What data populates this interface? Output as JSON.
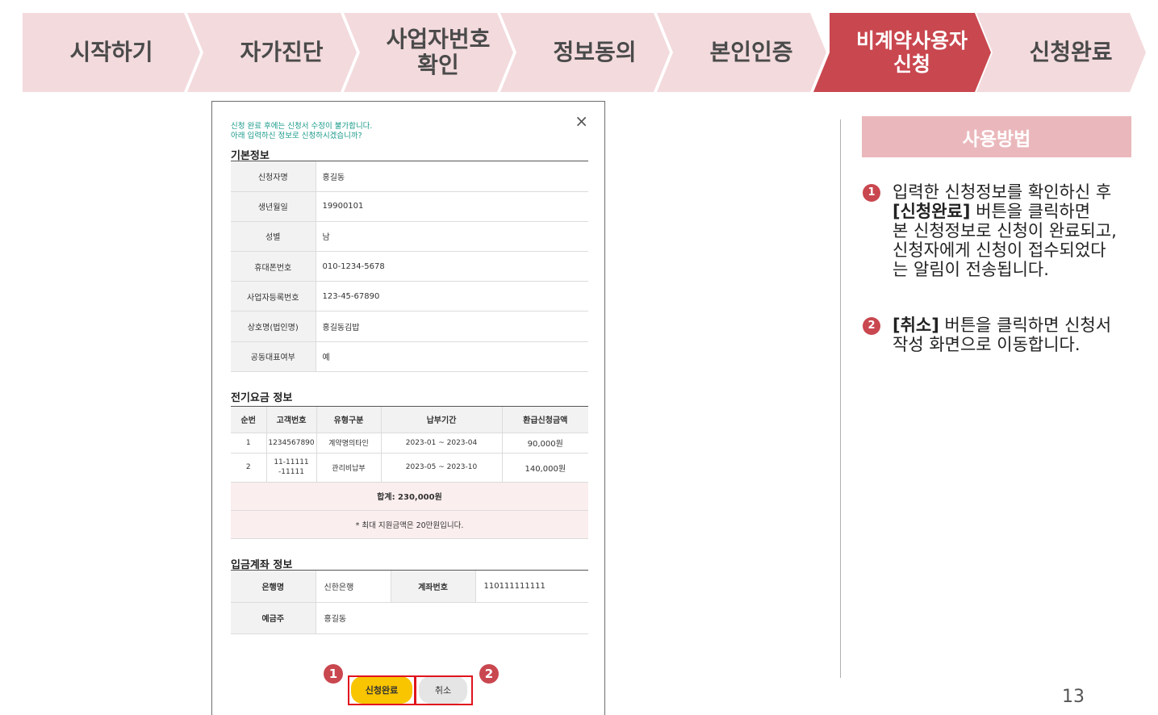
{
  "steps": [
    {
      "label": "시작하기",
      "active": false
    },
    {
      "label": "자가진단",
      "active": false
    },
    {
      "label": "사업자번호\n확인",
      "active": false
    },
    {
      "label": "정보동의",
      "active": false
    },
    {
      "label": "본인인증",
      "active": false
    },
    {
      "label": "비계약사용자\n신청",
      "active": true
    },
    {
      "label": "신청완료",
      "active": false
    }
  ],
  "modal": {
    "close_icon": "×",
    "notice_line1": "신청 완료 후에는 신청서 수정이 불가합니다.",
    "notice_line2": "아래 입력하신 정보로 신청하시겠습니까?",
    "basic_title": "기본정보",
    "basic": [
      {
        "label": "신청자명",
        "value": "홍길동"
      },
      {
        "label": "생년월일",
        "value": "19900101"
      },
      {
        "label": "성별",
        "value": "남"
      },
      {
        "label": "휴대폰번호",
        "value": "010-1234-5678"
      },
      {
        "label": "사업자등록번호",
        "value": "123-45-67890"
      },
      {
        "label": "상호명(법인명)",
        "value": "홍길동김밥"
      },
      {
        "label": "공동대표여부",
        "value": "예"
      }
    ],
    "fee_title": "전기요금 정보",
    "fee_headers": [
      "순번",
      "고객번호",
      "유형구분",
      "납부기간",
      "환급신청금액"
    ],
    "fee_rows": [
      [
        "1",
        "1234567890",
        "계약명의타인",
        "2023-01 ~ 2023-04",
        "90,000원"
      ],
      [
        "2",
        "11-11111\n-11111",
        "관리비납부",
        "2023-05 ~ 2023-10",
        "140,000원"
      ]
    ],
    "fee_total": "합계: 230,000원",
    "fee_note": "* 최대 지원금액은 20만원입니다.",
    "account_title": "입금계좌 정보",
    "bank_label": "은행명",
    "bank_value": "신한은행",
    "acct_label": "계좌번호",
    "acct_value": "110111111111",
    "holder_label": "예금주",
    "holder_value": "홍길동",
    "submit_label": "신청완료",
    "cancel_label": "취소",
    "marker1": "1",
    "marker2": "2"
  },
  "guide": {
    "title": "사용방법",
    "item1_num": "1",
    "item1_line1": "입력한 신청정보를 확인하신 후",
    "item1_bold": "[신청완료]",
    "item1_after_bold": " 버튼을 클릭하면",
    "item1_rest": "본 신청정보로 신청이 완료되고,\n신청자에게 신청이 접수되었다\n는 알림이 전송됩니다.",
    "item2_num": "2",
    "item2_bold": "[취소]",
    "item2_after_bold": " 버튼을 클릭하면 신청서",
    "item2_rest": "작성 화면으로 이동합니다."
  },
  "page_number": "13",
  "colors": {
    "accent": "#c9474f",
    "step_bg": "#f3dadd",
    "button_yellow": "#f9c400",
    "highlight": "#e0141d"
  }
}
